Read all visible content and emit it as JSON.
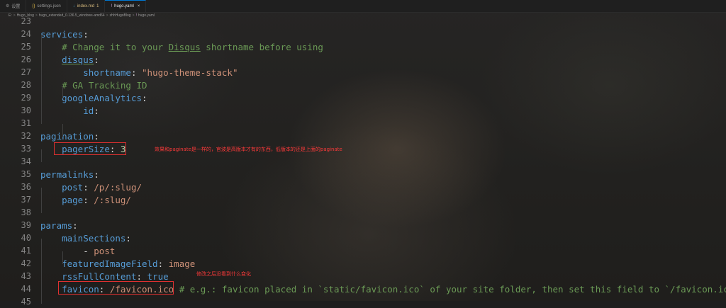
{
  "tabs": [
    {
      "label": "设置",
      "icon": "gear-icon"
    },
    {
      "label": "settings.json",
      "icon": "json-braces-icon"
    },
    {
      "label": "index.md",
      "icon": "markdown-icon",
      "badge": "1"
    },
    {
      "label": "hugo.yaml",
      "icon": "yaml-icon",
      "active": true,
      "close": "×"
    }
  ],
  "breadcrumb": {
    "parts": [
      "E:",
      "Hugo_blog",
      "hugo_extended_0.136.5_windows-amd64",
      "zhhHugoBlog",
      "hugo.yaml"
    ],
    "sep": ">"
  },
  "editor": {
    "lines": [
      {
        "num": "23",
        "tokens": []
      },
      {
        "num": "24",
        "tokens": [
          {
            "t": "k",
            "v": "services"
          },
          {
            "t": "p",
            "v": ":"
          }
        ]
      },
      {
        "num": "25",
        "tokens": [
          {
            "t": "c",
            "v": "    # Change it to your "
          },
          {
            "t": "cu",
            "v": "Disqus"
          },
          {
            "t": "c",
            "v": " shortname before using"
          }
        ]
      },
      {
        "num": "26",
        "tokens": [
          {
            "t": "p",
            "v": "    "
          },
          {
            "t": "ku",
            "v": "disqus"
          },
          {
            "t": "p",
            "v": ":"
          }
        ]
      },
      {
        "num": "27",
        "tokens": [
          {
            "t": "p",
            "v": "        "
          },
          {
            "t": "k",
            "v": "shortname"
          },
          {
            "t": "p",
            "v": ": "
          },
          {
            "t": "s",
            "v": "\"hugo-theme-stack\""
          }
        ]
      },
      {
        "num": "28",
        "tokens": [
          {
            "t": "c",
            "v": "    # GA Tracking ID"
          }
        ]
      },
      {
        "num": "29",
        "tokens": [
          {
            "t": "p",
            "v": "    "
          },
          {
            "t": "k",
            "v": "googleAnalytics"
          },
          {
            "t": "p",
            "v": ":"
          }
        ]
      },
      {
        "num": "30",
        "tokens": [
          {
            "t": "p",
            "v": "        "
          },
          {
            "t": "k",
            "v": "id"
          },
          {
            "t": "p",
            "v": ":"
          }
        ]
      },
      {
        "num": "31",
        "tokens": []
      },
      {
        "num": "32",
        "tokens": [
          {
            "t": "k",
            "v": "pagination"
          },
          {
            "t": "p",
            "v": ":"
          }
        ]
      },
      {
        "num": "33",
        "tokens": [
          {
            "t": "p",
            "v": "    "
          },
          {
            "t": "k",
            "v": "pagerSize"
          },
          {
            "t": "p",
            "v": ": "
          },
          {
            "t": "n",
            "v": "3"
          }
        ]
      },
      {
        "num": "34",
        "tokens": []
      },
      {
        "num": "35",
        "tokens": [
          {
            "t": "k",
            "v": "permalinks"
          },
          {
            "t": "p",
            "v": ":"
          }
        ]
      },
      {
        "num": "36",
        "tokens": [
          {
            "t": "p",
            "v": "    "
          },
          {
            "t": "k",
            "v": "post"
          },
          {
            "t": "p",
            "v": ": "
          },
          {
            "t": "s",
            "v": "/p/:slug/"
          }
        ]
      },
      {
        "num": "37",
        "tokens": [
          {
            "t": "p",
            "v": "    "
          },
          {
            "t": "k",
            "v": "page"
          },
          {
            "t": "p",
            "v": ": "
          },
          {
            "t": "s",
            "v": "/:slug/"
          }
        ]
      },
      {
        "num": "38",
        "tokens": []
      },
      {
        "num": "39",
        "tokens": [
          {
            "t": "k",
            "v": "params"
          },
          {
            "t": "p",
            "v": ":"
          }
        ]
      },
      {
        "num": "40",
        "tokens": [
          {
            "t": "p",
            "v": "    "
          },
          {
            "t": "k",
            "v": "mainSections"
          },
          {
            "t": "p",
            "v": ":"
          }
        ]
      },
      {
        "num": "41",
        "tokens": [
          {
            "t": "p",
            "v": "        - "
          },
          {
            "t": "s",
            "v": "post"
          }
        ]
      },
      {
        "num": "42",
        "tokens": [
          {
            "t": "p",
            "v": "    "
          },
          {
            "t": "k",
            "v": "featuredImageField"
          },
          {
            "t": "p",
            "v": ": "
          },
          {
            "t": "s",
            "v": "image"
          }
        ]
      },
      {
        "num": "43",
        "tokens": [
          {
            "t": "p",
            "v": "    "
          },
          {
            "t": "k",
            "v": "rssFullContent"
          },
          {
            "t": "p",
            "v": ": "
          },
          {
            "t": "k",
            "v": "true"
          }
        ]
      },
      {
        "num": "44",
        "tokens": [
          {
            "t": "p",
            "v": "    "
          },
          {
            "t": "k",
            "v": "favicon"
          },
          {
            "t": "p",
            "v": ": "
          },
          {
            "t": "s",
            "v": "/favicon.ico"
          },
          {
            "t": "c",
            "v": " # e.g.: favicon placed in `static/favicon.ico` of your site folder, then set this field to `/favicon.ico` ("
          }
        ]
      },
      {
        "num": "45",
        "tokens": []
      }
    ]
  },
  "annotations": {
    "note_pagination": "效果和paginate是一样的，官波是高版本才有的东西，低版本的还是上面的paginate",
    "note_favicon": "修改之后没看到什么变化"
  },
  "colors": {
    "keyword": "#569cd6",
    "string": "#ce9178",
    "comment": "#6a9955",
    "number": "#b5cea8",
    "annotation_red": "#e03030"
  }
}
